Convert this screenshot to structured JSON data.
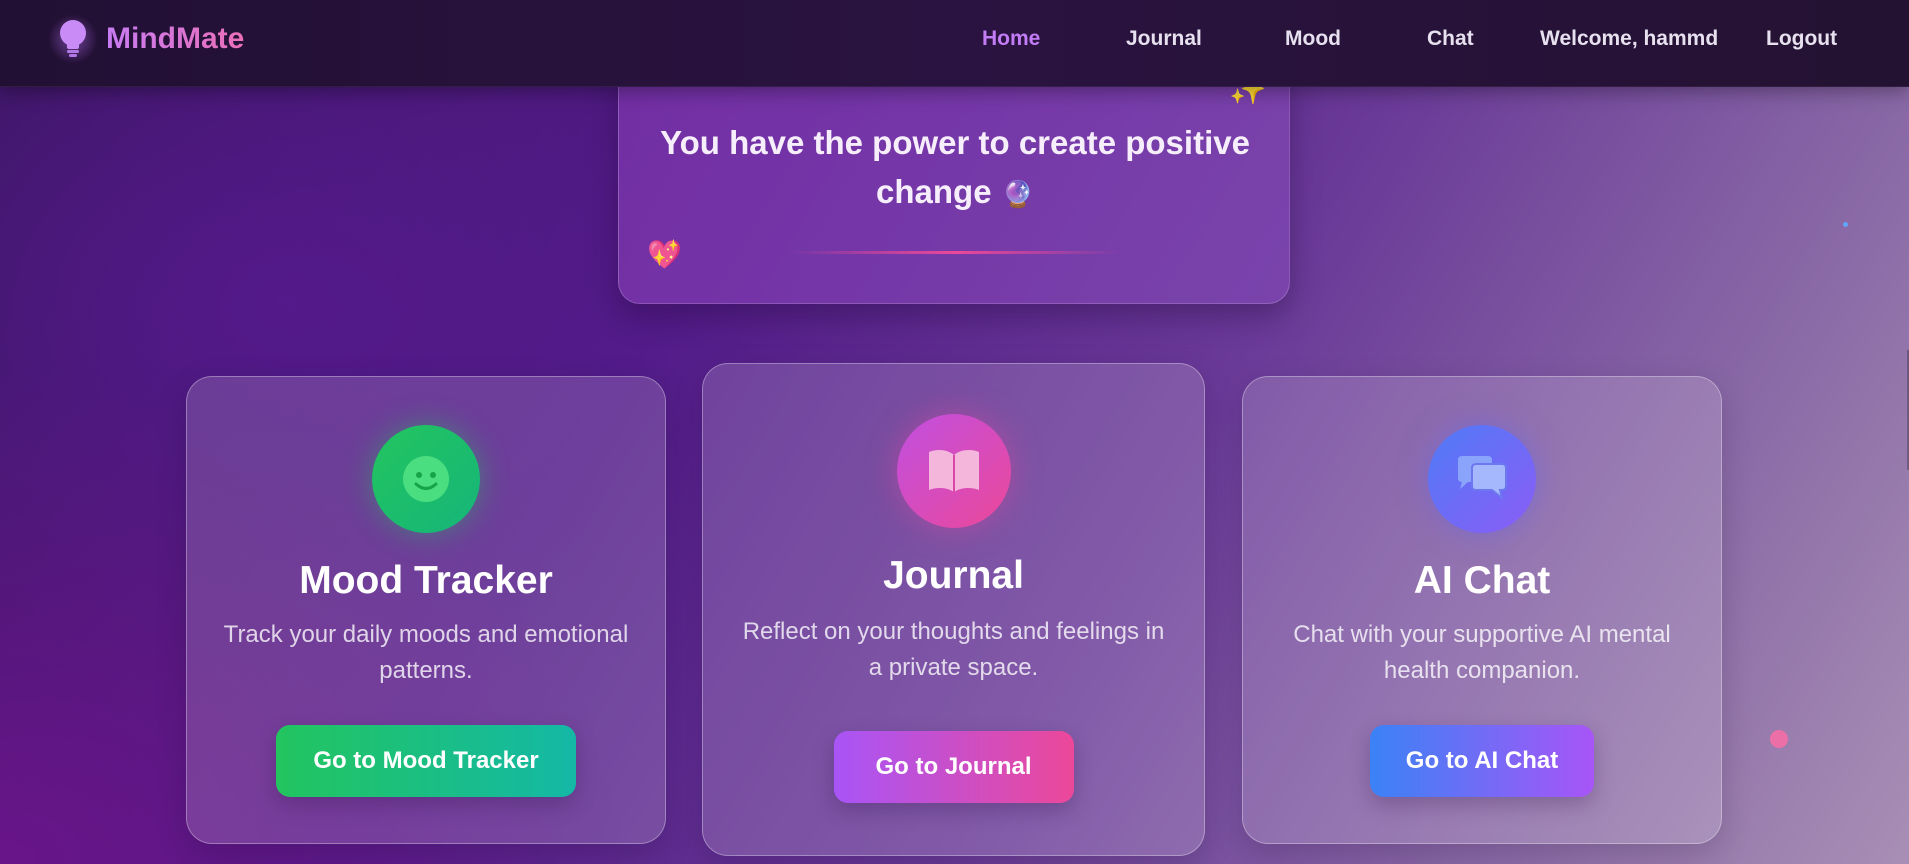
{
  "brand": {
    "name": "MindMate",
    "icon": "lightbulb-icon"
  },
  "nav": {
    "links": [
      "Home",
      "Journal",
      "Mood",
      "Chat"
    ],
    "active": "Home",
    "welcome": "Welcome, hammd",
    "logout": "Logout"
  },
  "quote": {
    "text": "You have the power to create positive change",
    "emoji": "🔮",
    "sparkle": "✨",
    "heart": "💖"
  },
  "cards": [
    {
      "title": "Mood Tracker",
      "description": "Track your daily moods and emotional patterns.",
      "button": "Go to Mood Tracker",
      "icon": "smiley-icon",
      "colors": [
        "#22c55e",
        "#14b8a6"
      ]
    },
    {
      "title": "Journal",
      "description": "Reflect on your thoughts and feelings in a private space.",
      "button": "Go to Journal",
      "icon": "book-icon",
      "colors": [
        "#a855f7",
        "#ec4899"
      ]
    },
    {
      "title": "AI Chat",
      "description": "Chat with your supportive AI mental health companion.",
      "button": "Go to AI Chat",
      "icon": "chat-bubbles-icon",
      "colors": [
        "#3b82f6",
        "#a855f7"
      ]
    }
  ],
  "accent": {
    "navActive": "#c27cf5",
    "brandGradient": [
      "#c67cf3",
      "#ec6fb8"
    ]
  }
}
